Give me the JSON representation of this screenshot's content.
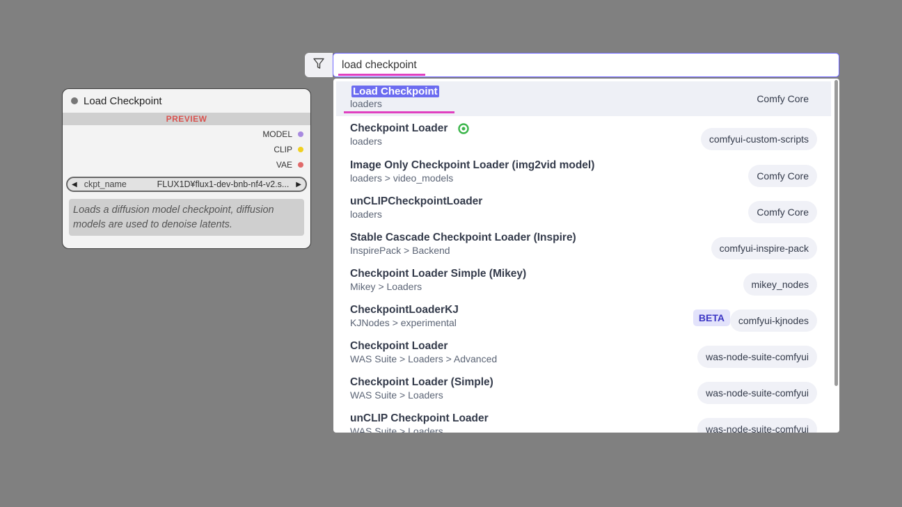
{
  "node": {
    "title": "Load Checkpoint",
    "preview_label": "PREVIEW",
    "outputs": [
      {
        "label": "MODEL",
        "color": "#a88ae0"
      },
      {
        "label": "CLIP",
        "color": "#f0d020"
      },
      {
        "label": "VAE",
        "color": "#e06a6a"
      }
    ],
    "widget": {
      "name": "ckpt_name",
      "value": "FLUX1D¥flux1-dev-bnb-nf4-v2.s..."
    },
    "description": "Loads a diffusion model checkpoint, diffusion models are used to denoise latents."
  },
  "search": {
    "value": "load checkpoint",
    "filter_icon": "filter-icon"
  },
  "results": [
    {
      "title": "Load Checkpoint",
      "category": "loaders",
      "source": "Comfy Core",
      "selected": true
    },
    {
      "title": "Checkpoint Loader",
      "category": "loaders",
      "source": "comfyui-custom-scripts",
      "icon": "custom-scripts-icon"
    },
    {
      "title": "Image Only Checkpoint Loader (img2vid model)",
      "category": "loaders > video_models",
      "source": "Comfy Core"
    },
    {
      "title": "unCLIPCheckpointLoader",
      "category": "loaders",
      "source": "Comfy Core"
    },
    {
      "title": "Stable Cascade Checkpoint Loader (Inspire)",
      "category": "InspirePack > Backend",
      "source": "comfyui-inspire-pack"
    },
    {
      "title": "Checkpoint Loader Simple (Mikey)",
      "category": "Mikey > Loaders",
      "source": "mikey_nodes"
    },
    {
      "title": "CheckpointLoaderKJ",
      "category": "KJNodes > experimental",
      "source": "comfyui-kjnodes",
      "tag": "BETA"
    },
    {
      "title": "Checkpoint Loader",
      "category": "WAS Suite > Loaders > Advanced",
      "source": "was-node-suite-comfyui"
    },
    {
      "title": "Checkpoint Loader (Simple)",
      "category": "WAS Suite > Loaders",
      "source": "was-node-suite-comfyui"
    },
    {
      "title": "unCLIP Checkpoint Loader",
      "category": "WAS Suite > Loaders",
      "source": "was-node-suite-comfyui"
    }
  ]
}
